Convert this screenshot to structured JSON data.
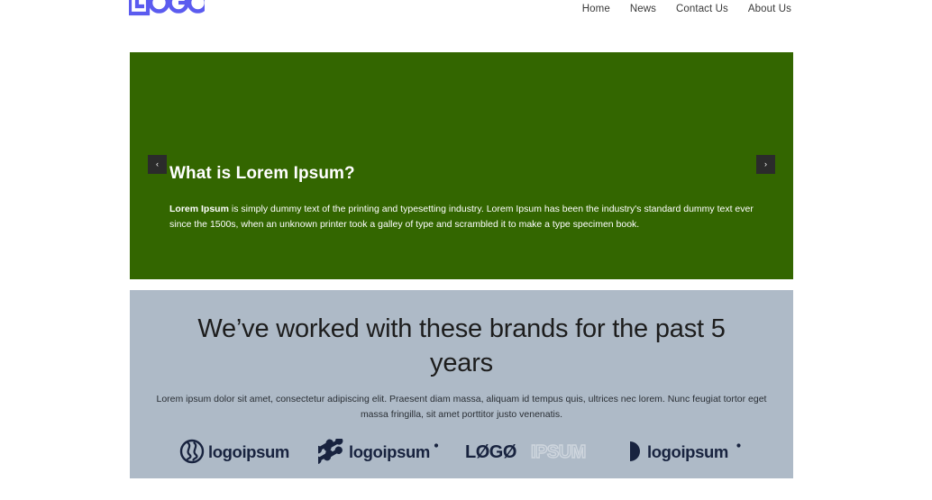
{
  "header": {
    "logo_text": "LOGO",
    "logo_color": "#5b5bef",
    "nav": [
      {
        "label": "Home"
      },
      {
        "label": "News"
      },
      {
        "label": "Contact Us"
      },
      {
        "label": "About Us"
      }
    ]
  },
  "hero": {
    "background_color": "#336600",
    "title": "What is Lorem Ipsum?",
    "body_lead": "Lorem Ipsum",
    "body_rest": " is simply dummy text of the printing and typesetting industry. Lorem Ipsum has been the industry's standard dummy text ever since the 1500s, when an unknown printer took a galley of type and scrambled it to make a type specimen book.",
    "prev_label": "‹",
    "next_label": "›"
  },
  "brands": {
    "background_color": "#aebac7",
    "title": "We’ve worked with these brands for the past 5 years",
    "subtitle": "Lorem ipsum dolor sit amet, consectetur adipiscing elit. Praesent diam massa, aliquam id tempus quis, ultrices nec lorem. Nunc feugiat tortor eget massa fringilla, sit amet porttitor justo venenatis.",
    "logo_color": "#18233f",
    "logos": [
      {
        "name": "logoipsum-circle-waves",
        "wordmark": "logoipsum",
        "mark": "circle-waves",
        "trademark": ""
      },
      {
        "name": "logoipsum-nodes",
        "wordmark": "logoipsum",
        "mark": "nodes",
        "trademark": "•"
      },
      {
        "name": "logoipsum-outline",
        "wordmark_solid": "LØGØ",
        "wordmark_outline": "IPSUM",
        "mark": "none",
        "trademark": ""
      },
      {
        "name": "logoipsum-half-moon",
        "wordmark": "logoipsum",
        "mark": "half-moon",
        "trademark": "•"
      }
    ]
  }
}
